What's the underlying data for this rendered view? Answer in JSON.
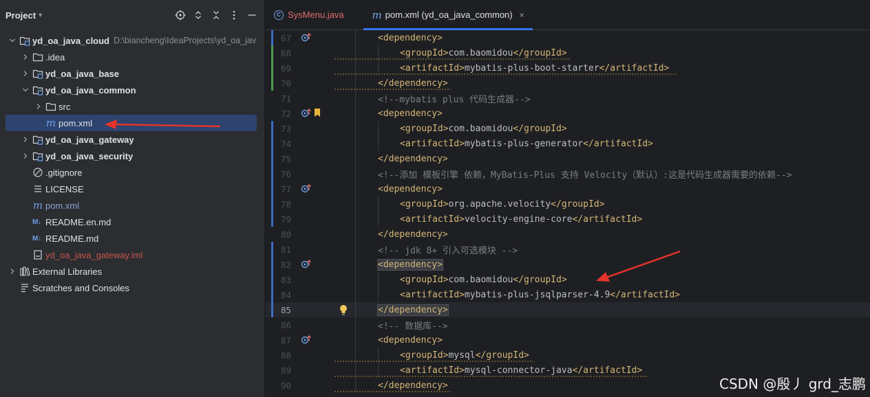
{
  "project_panel": {
    "title": "Project",
    "tree": [
      {
        "label": "yd_oa_java_cloud",
        "path": "D:\\biancheng\\IdeaProjects\\yd_oa_jav",
        "level": 0,
        "expanded": true,
        "icon": "module-folder-icon",
        "style": "bold"
      },
      {
        "label": ".idea",
        "level": 1,
        "expanded": false,
        "icon": "folder-icon",
        "style": "normal"
      },
      {
        "label": "yd_oa_java_base",
        "level": 1,
        "expanded": false,
        "icon": "module-folder-icon",
        "style": "bold"
      },
      {
        "label": "yd_oa_java_common",
        "level": 1,
        "expanded": true,
        "icon": "module-folder-icon",
        "style": "bold"
      },
      {
        "label": "src",
        "level": 2,
        "expanded": false,
        "icon": "folder-icon",
        "style": "normal"
      },
      {
        "label": "pom.xml",
        "level": 2,
        "icon": "maven-icon",
        "style": "normal",
        "selected": true
      },
      {
        "label": "yd_oa_java_gateway",
        "level": 1,
        "expanded": false,
        "icon": "module-folder-icon",
        "style": "bold"
      },
      {
        "label": "yd_oa_java_security",
        "level": 1,
        "expanded": false,
        "icon": "module-folder-icon",
        "style": "bold"
      },
      {
        "label": ".gitignore",
        "level": 1,
        "icon": "ignore-file-icon",
        "style": "normal"
      },
      {
        "label": "LICENSE",
        "level": 1,
        "icon": "text-file-icon",
        "style": "normal"
      },
      {
        "label": "pom.xml",
        "level": 1,
        "icon": "maven-icon",
        "style": "blue"
      },
      {
        "label": "README.en.md",
        "level": 1,
        "icon": "markdown-icon",
        "style": "normal"
      },
      {
        "label": "README.md",
        "level": 1,
        "icon": "markdown-icon",
        "style": "normal"
      },
      {
        "label": "yd_oa_java_gateway.iml",
        "level": 1,
        "icon": "iml-file-icon",
        "style": "red"
      },
      {
        "label": "External Libraries",
        "level": 0,
        "expanded": false,
        "icon": "library-icon",
        "style": "normal"
      },
      {
        "label": "Scratches and Consoles",
        "level": 0,
        "icon": "scratches-icon",
        "style": "normal"
      }
    ]
  },
  "editor": {
    "tabs": [
      {
        "label": "SysMenu.java",
        "icon": "class-icon",
        "active": false
      },
      {
        "label": "pom.xml (yd_oa_java_common)",
        "icon": "maven-icon",
        "active": true,
        "close": "×"
      }
    ],
    "current_line": 85,
    "lines": [
      {
        "n": 67,
        "indent": 1,
        "parts": [
          [
            "tag",
            "<dependency>"
          ]
        ],
        "gutter": "blue",
        "icon": "override",
        "wavy": false
      },
      {
        "n": 68,
        "indent": 2,
        "parts": [
          [
            "tag",
            "<groupId>"
          ],
          [
            "txt",
            "com.baomidou"
          ],
          [
            "tag",
            "</groupId>"
          ]
        ],
        "gutter": "green",
        "wavy": true
      },
      {
        "n": 69,
        "indent": 2,
        "parts": [
          [
            "tag",
            "<artifactId>"
          ],
          [
            "txt",
            "mybatis-plus-boot-starter"
          ],
          [
            "tag",
            "</artifactId>"
          ]
        ],
        "gutter": "green",
        "wavy": true
      },
      {
        "n": 70,
        "indent": 1,
        "parts": [
          [
            "tag",
            "</dependency>"
          ]
        ],
        "gutter": "green",
        "wavy": true
      },
      {
        "n": 71,
        "indent": 1,
        "parts": [
          [
            "cmt",
            "<!--mybatis plus 代码生成器-->"
          ]
        ],
        "gutter": ""
      },
      {
        "n": 72,
        "indent": 1,
        "parts": [
          [
            "tag",
            "<dependency>"
          ]
        ],
        "gutter": "",
        "icon": "override-bookmark"
      },
      {
        "n": 73,
        "indent": 2,
        "parts": [
          [
            "tag",
            "<groupId>"
          ],
          [
            "txt",
            "com.baomidou"
          ],
          [
            "tag",
            "</groupId>"
          ]
        ],
        "gutter": "blue"
      },
      {
        "n": 74,
        "indent": 2,
        "parts": [
          [
            "tag",
            "<artifactId>"
          ],
          [
            "txt",
            "mybatis-plus-generator"
          ],
          [
            "tag",
            "</artifactId>"
          ]
        ],
        "gutter": "blue"
      },
      {
        "n": 75,
        "indent": 1,
        "parts": [
          [
            "tag",
            "</dependency>"
          ]
        ],
        "gutter": "blue"
      },
      {
        "n": 76,
        "indent": 1,
        "parts": [
          [
            "cmt",
            "<!--添加 模板引擎 依赖，MyBatis-Plus 支持 Velocity（默认）:这是代码生成器需要的依赖-->"
          ]
        ],
        "gutter": "blue"
      },
      {
        "n": 77,
        "indent": 1,
        "parts": [
          [
            "tag",
            "<dependency>"
          ]
        ],
        "gutter": "blue",
        "icon": "override"
      },
      {
        "n": 78,
        "indent": 2,
        "parts": [
          [
            "tag",
            "<groupId>"
          ],
          [
            "txt",
            "org.apache.velocity"
          ],
          [
            "tag",
            "</groupId>"
          ]
        ],
        "gutter": "blue"
      },
      {
        "n": 79,
        "indent": 2,
        "parts": [
          [
            "tag",
            "<artifactId>"
          ],
          [
            "txt",
            "velocity-engine-core"
          ],
          [
            "tag",
            "</artifactId>"
          ]
        ],
        "gutter": "blue"
      },
      {
        "n": 80,
        "indent": 1,
        "parts": [
          [
            "tag",
            "</dependency>"
          ]
        ],
        "gutter": ""
      },
      {
        "n": 81,
        "indent": 1,
        "parts": [
          [
            "cmt",
            "<!-- jdk 8+ 引入可选模块 -->"
          ]
        ],
        "gutter": "blue"
      },
      {
        "n": 82,
        "indent": 1,
        "parts": [
          [
            "tag",
            "<dependency>"
          ]
        ],
        "gutter": "blue",
        "icon": "override",
        "highlight": true
      },
      {
        "n": 83,
        "indent": 2,
        "parts": [
          [
            "tag",
            "<groupId>"
          ],
          [
            "txt",
            "com.baomidou"
          ],
          [
            "tag",
            "</groupId>"
          ]
        ],
        "gutter": "blue"
      },
      {
        "n": 84,
        "indent": 2,
        "parts": [
          [
            "tag",
            "<artifactId>"
          ],
          [
            "txt",
            "mybatis-plus-jsqlparser-4.9"
          ],
          [
            "tag",
            "</artifactId>"
          ]
        ],
        "gutter": "blue"
      },
      {
        "n": 85,
        "indent": 1,
        "parts": [
          [
            "tag",
            "</dependency>"
          ]
        ],
        "gutter": "blue",
        "bulb": true,
        "highlight": true
      },
      {
        "n": 86,
        "indent": 1,
        "parts": [
          [
            "cmt",
            "<!-- 数据库-->"
          ]
        ],
        "gutter": ""
      },
      {
        "n": 87,
        "indent": 1,
        "parts": [
          [
            "tag",
            "<dependency>"
          ]
        ],
        "gutter": "",
        "icon": "override"
      },
      {
        "n": 88,
        "indent": 2,
        "parts": [
          [
            "tag",
            "<groupId>"
          ],
          [
            "txt",
            "mysql"
          ],
          [
            "tag",
            "</groupId>"
          ]
        ],
        "gutter": "",
        "wavy": true
      },
      {
        "n": 89,
        "indent": 2,
        "parts": [
          [
            "tag",
            "<artifactId>"
          ],
          [
            "txt",
            "mysql-connector-java"
          ],
          [
            "tag",
            "</artifactId>"
          ]
        ],
        "gutter": "",
        "wavy": true
      },
      {
        "n": 90,
        "indent": 1,
        "parts": [
          [
            "tag",
            "</dependency>"
          ]
        ],
        "gutter": "",
        "wavy": true
      }
    ]
  },
  "watermark": "CSDN @殷丿 grd_志鹏",
  "colors": {
    "gutter_blue": "#3e6cc5",
    "gutter_green": "#499c54",
    "arrow_red": "#e5332a",
    "selection": "#2e436e"
  }
}
